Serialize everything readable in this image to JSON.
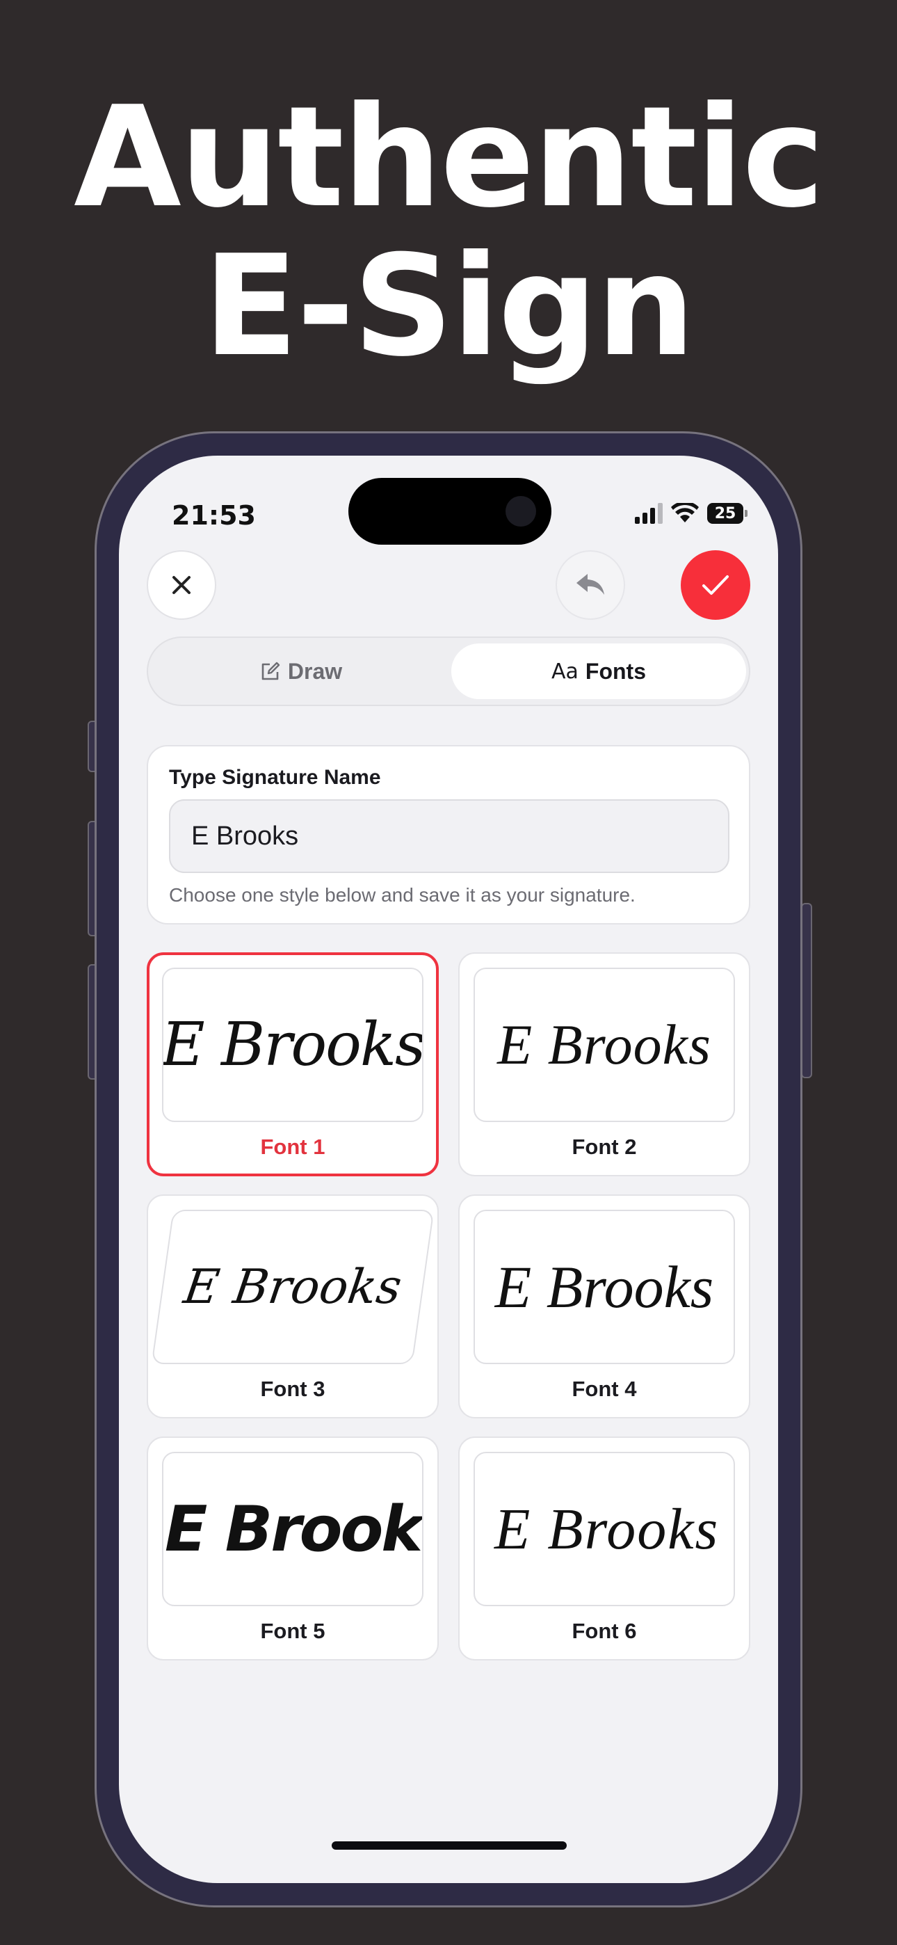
{
  "headline": {
    "line1": "Authentic",
    "line2": "E-Sign"
  },
  "status_bar": {
    "time": "21:53",
    "battery": "25"
  },
  "toolbar": {
    "close_icon": "close-icon",
    "undo_icon": "undo-icon",
    "confirm_icon": "checkmark-icon",
    "confirm_color": "#f72f3a"
  },
  "tabs": [
    {
      "label": "Draw",
      "icon": "pencil-square-icon",
      "selected": false
    },
    {
      "label": "Fonts",
      "icon_text": "Aa",
      "selected": true
    }
  ],
  "signature_form": {
    "label": "Type Signature Name",
    "value": "E Brooks",
    "hint": "Choose one style below and save it as your signature."
  },
  "fonts": [
    {
      "label": "Font 1",
      "preview": "E Brooks",
      "selected": true
    },
    {
      "label": "Font 2",
      "preview": "E Brooks",
      "selected": false
    },
    {
      "label": "Font 3",
      "preview": "E Brooks",
      "selected": false
    },
    {
      "label": "Font 4",
      "preview": "E Brooks",
      "selected": false
    },
    {
      "label": "Font 5",
      "preview": "E Brook",
      "selected": false
    },
    {
      "label": "Font 6",
      "preview": "E Brooks",
      "selected": false
    }
  ],
  "accent_color": "#ef3340",
  "background_color": "#2f2a2b"
}
